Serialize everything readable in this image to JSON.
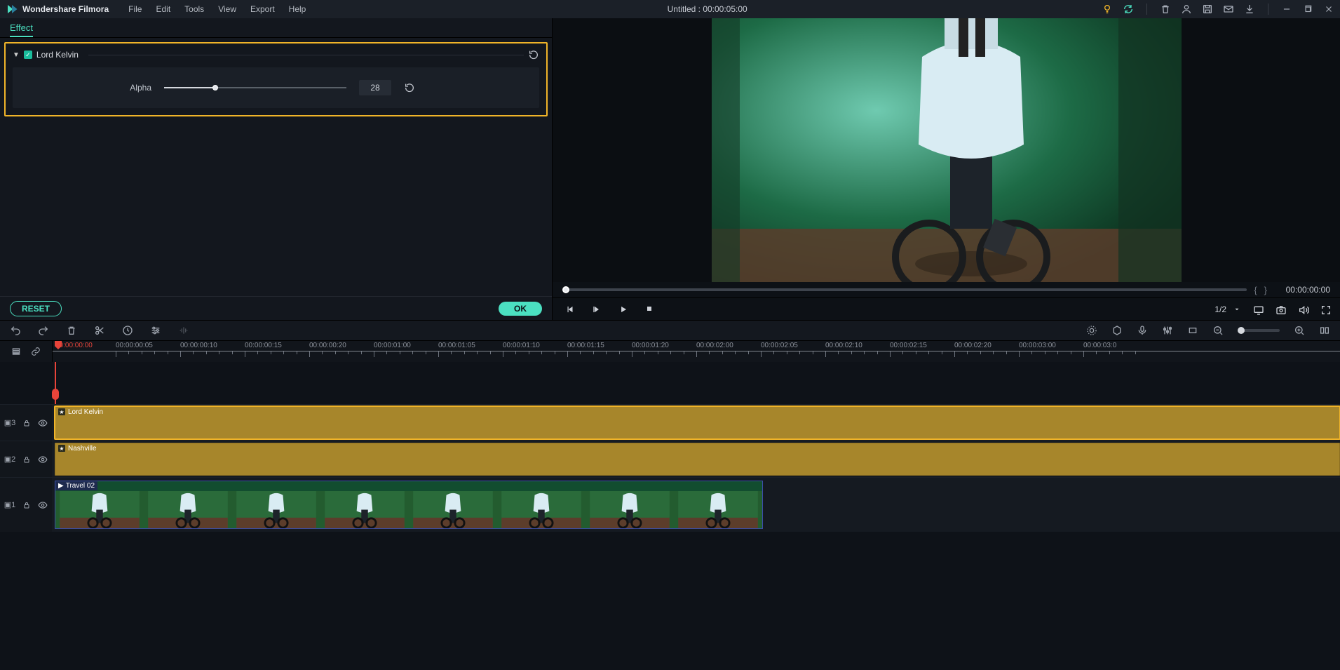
{
  "titlebar": {
    "app": "Wondershare Filmora",
    "menu": [
      "File",
      "Edit",
      "Tools",
      "View",
      "Export",
      "Help"
    ],
    "project_title": "Untitled : 00:00:05:00"
  },
  "effect_panel": {
    "tab": "Effect",
    "name": "Lord Kelvin",
    "alpha_label": "Alpha",
    "alpha_value": "28",
    "alpha_pct": 28,
    "reset": "RESET",
    "ok": "OK"
  },
  "preview": {
    "timecode": "00:00:00:00",
    "scale": "1/2"
  },
  "ruler": {
    "start_red": "00:00:00:00",
    "ticks": [
      "00:00:00:05",
      "00:00:00:10",
      "00:00:00:15",
      "00:00:00:20",
      "00:00:01:00",
      "00:00:01:05",
      "00:00:01:10",
      "00:00:01:15",
      "00:00:01:20",
      "00:00:02:00",
      "00:00:02:05",
      "00:00:02:10",
      "00:00:02:15",
      "00:00:02:20",
      "00:00:03:00",
      "00:00:03:0"
    ]
  },
  "tracks": {
    "t3": {
      "idx": "3",
      "clip": "Lord Kelvin"
    },
    "t2": {
      "idx": "2",
      "clip": "Nashville"
    },
    "t1": {
      "idx": "1",
      "clip": "Travel 02"
    }
  }
}
